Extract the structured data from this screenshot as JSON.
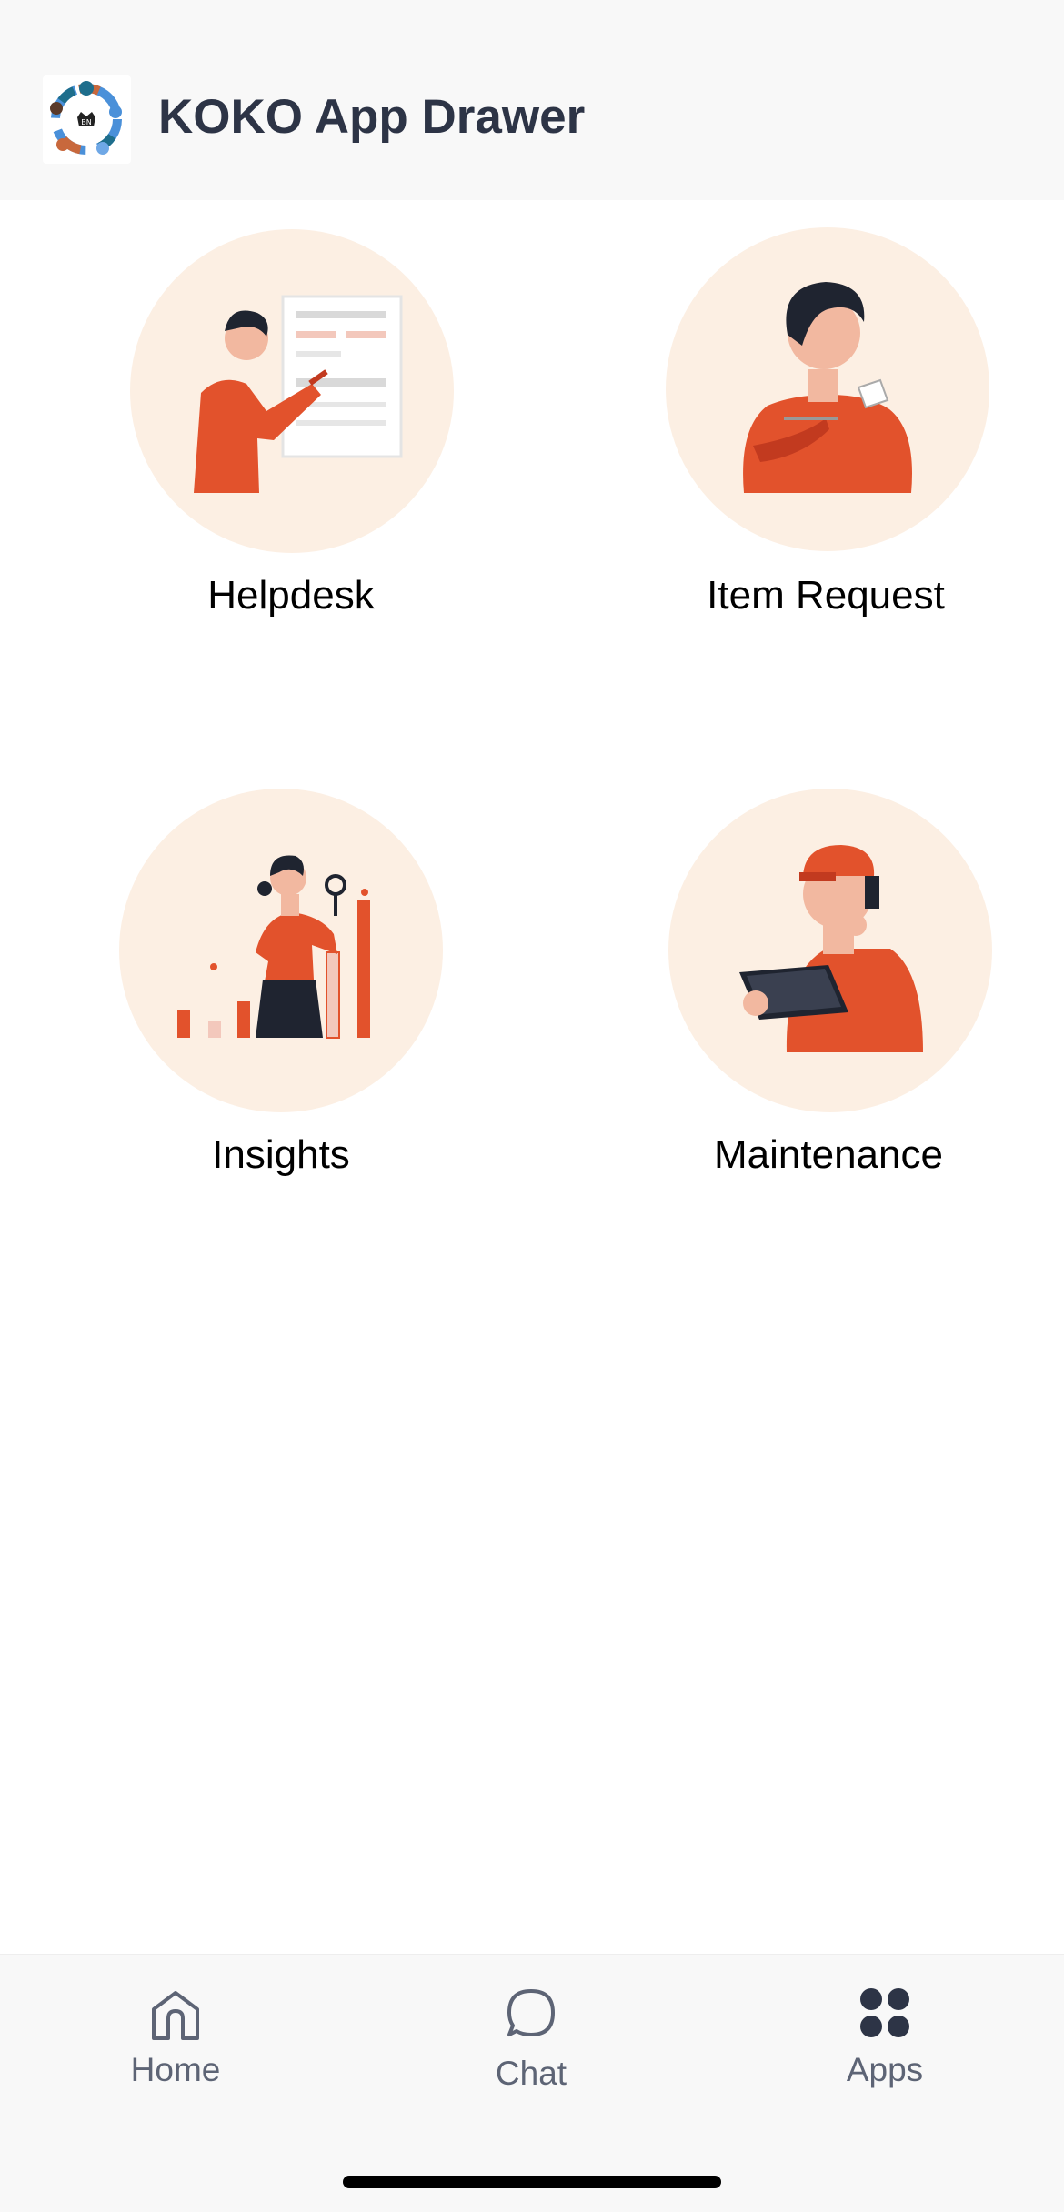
{
  "header": {
    "title": "KOKO App Drawer",
    "logo_icon": "koko-community-logo"
  },
  "apps": [
    {
      "label": "Helpdesk",
      "icon": "helpdesk-illustration"
    },
    {
      "label": "Item Request",
      "icon": "item-request-illustration"
    },
    {
      "label": "Insights",
      "icon": "insights-illustration"
    },
    {
      "label": "Maintenance",
      "icon": "maintenance-illustration"
    }
  ],
  "tabbar": {
    "tabs": [
      {
        "label": "Home",
        "icon": "home-icon",
        "active": false
      },
      {
        "label": "Chat",
        "icon": "chat-icon",
        "active": false
      },
      {
        "label": "Apps",
        "icon": "apps-grid-icon",
        "active": true
      }
    ]
  },
  "colors": {
    "header_bg": "#f8f8f8",
    "title_text": "#2d3446",
    "circle_bg": "#fcefe3",
    "accent_orange": "#e2522c",
    "tab_inactive": "#5d6475",
    "tab_active_icon": "#2d3446"
  }
}
